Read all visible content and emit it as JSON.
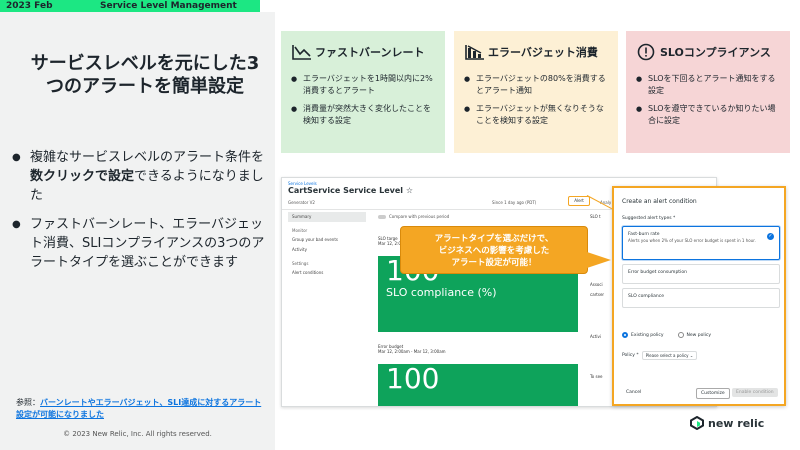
{
  "header": {
    "date": "2023 Feb",
    "section": "Service Level Management"
  },
  "left": {
    "title": "サービスレベルを元にした3つのアラートを簡単設定",
    "bullets": [
      {
        "pre": "複雑なサービスレベルのアラート条件を",
        "bold": "数クリックで設定",
        "post": "できるようになりました"
      },
      {
        "pre": "ファストバーンレート、エラーバジェット消費、SLIコンプライアンスの3つのアラートタイプを選ぶことができます",
        "bold": "",
        "post": ""
      }
    ],
    "ref_prefix": "参照：",
    "ref_link": "バーンレートやエラーバジェット、SLI達成に対するアラート設定が可能になりました",
    "copyright": "© 2023 New Relic, Inc. All rights reserved."
  },
  "cards": [
    {
      "title": "ファストバーンレート",
      "icon": "fast-burn-icon",
      "items": [
        "エラーバジェットを1時間以内に2%消費するとアラート",
        "消費量が突然大きく変化したことを検知する設定"
      ]
    },
    {
      "title": "エラーバジェット消費",
      "icon": "error-budget-icon",
      "items": [
        "エラーバジェットの80%を消費するとアラート通知",
        "エラーバジェットが無くなりそうなことを検知する設定"
      ]
    },
    {
      "title": "SLOコンプライアンス",
      "icon": "exclamation-icon",
      "items": [
        "SLOを下回るとアラート通知をする設定",
        "SLOを遵守できているか知りたい場合に設定"
      ]
    }
  ],
  "screenshot": {
    "crumb": "Service Levels",
    "title": "CartService Service Level",
    "toolbar": {
      "env": "Generator V2",
      "since": "Since 1 day ago (PDT)",
      "alert": "Alert",
      "analyze": "Analy"
    },
    "sidebar": {
      "summary": "Summary",
      "monitor": "Monitor",
      "drop_events": "Group your bad events",
      "activity": "Activity",
      "settings": "Settings",
      "alert_conditions": "Alert conditions"
    },
    "compare": "Compare with previous period",
    "slo_label": "SLO targe",
    "slo_sub": "Mar 12, 2:0",
    "tile1_value": "100",
    "tile1_label": "SLO compliance (%)",
    "eb_label": "Error budget",
    "eb_sub": "Mar 12, 2:00am - Mar 12, 3:00am",
    "tile2_value": "100",
    "frag_slo": "SLO t",
    "frag_assoc": "Associ",
    "frag_cart": "cartser",
    "frag_activ": "Activi",
    "frag_tosee": "To see"
  },
  "dialog": {
    "title": "Create an alert condition",
    "suggested_label": "Suggested alert types *",
    "options": [
      {
        "name": "Fast-burn rate",
        "desc": "Alerts you when 2% of your SLO error budget is spent in 1 hour."
      },
      {
        "name": "Error budget consumption",
        "desc": ""
      },
      {
        "name": "SLO compliance",
        "desc": ""
      }
    ],
    "existing_policy": "Existing policy",
    "new_policy": "New policy",
    "policy_label": "Policy *",
    "policy_placeholder": "Please select a policy",
    "cancel": "Cancel",
    "customize": "Customize",
    "enable": "Enable condition"
  },
  "callout": {
    "lines": [
      "アラートタイプを選ぶだけで、",
      "ビジネスへの影響を考慮した",
      "アラート設定が可能！"
    ]
  },
  "logo": {
    "text": "new relic"
  },
  "colors": {
    "brand_green": "#1ce783",
    "callout_orange": "#f4a623",
    "tile_green": "#0ea35b",
    "link_blue": "#0c74df"
  }
}
